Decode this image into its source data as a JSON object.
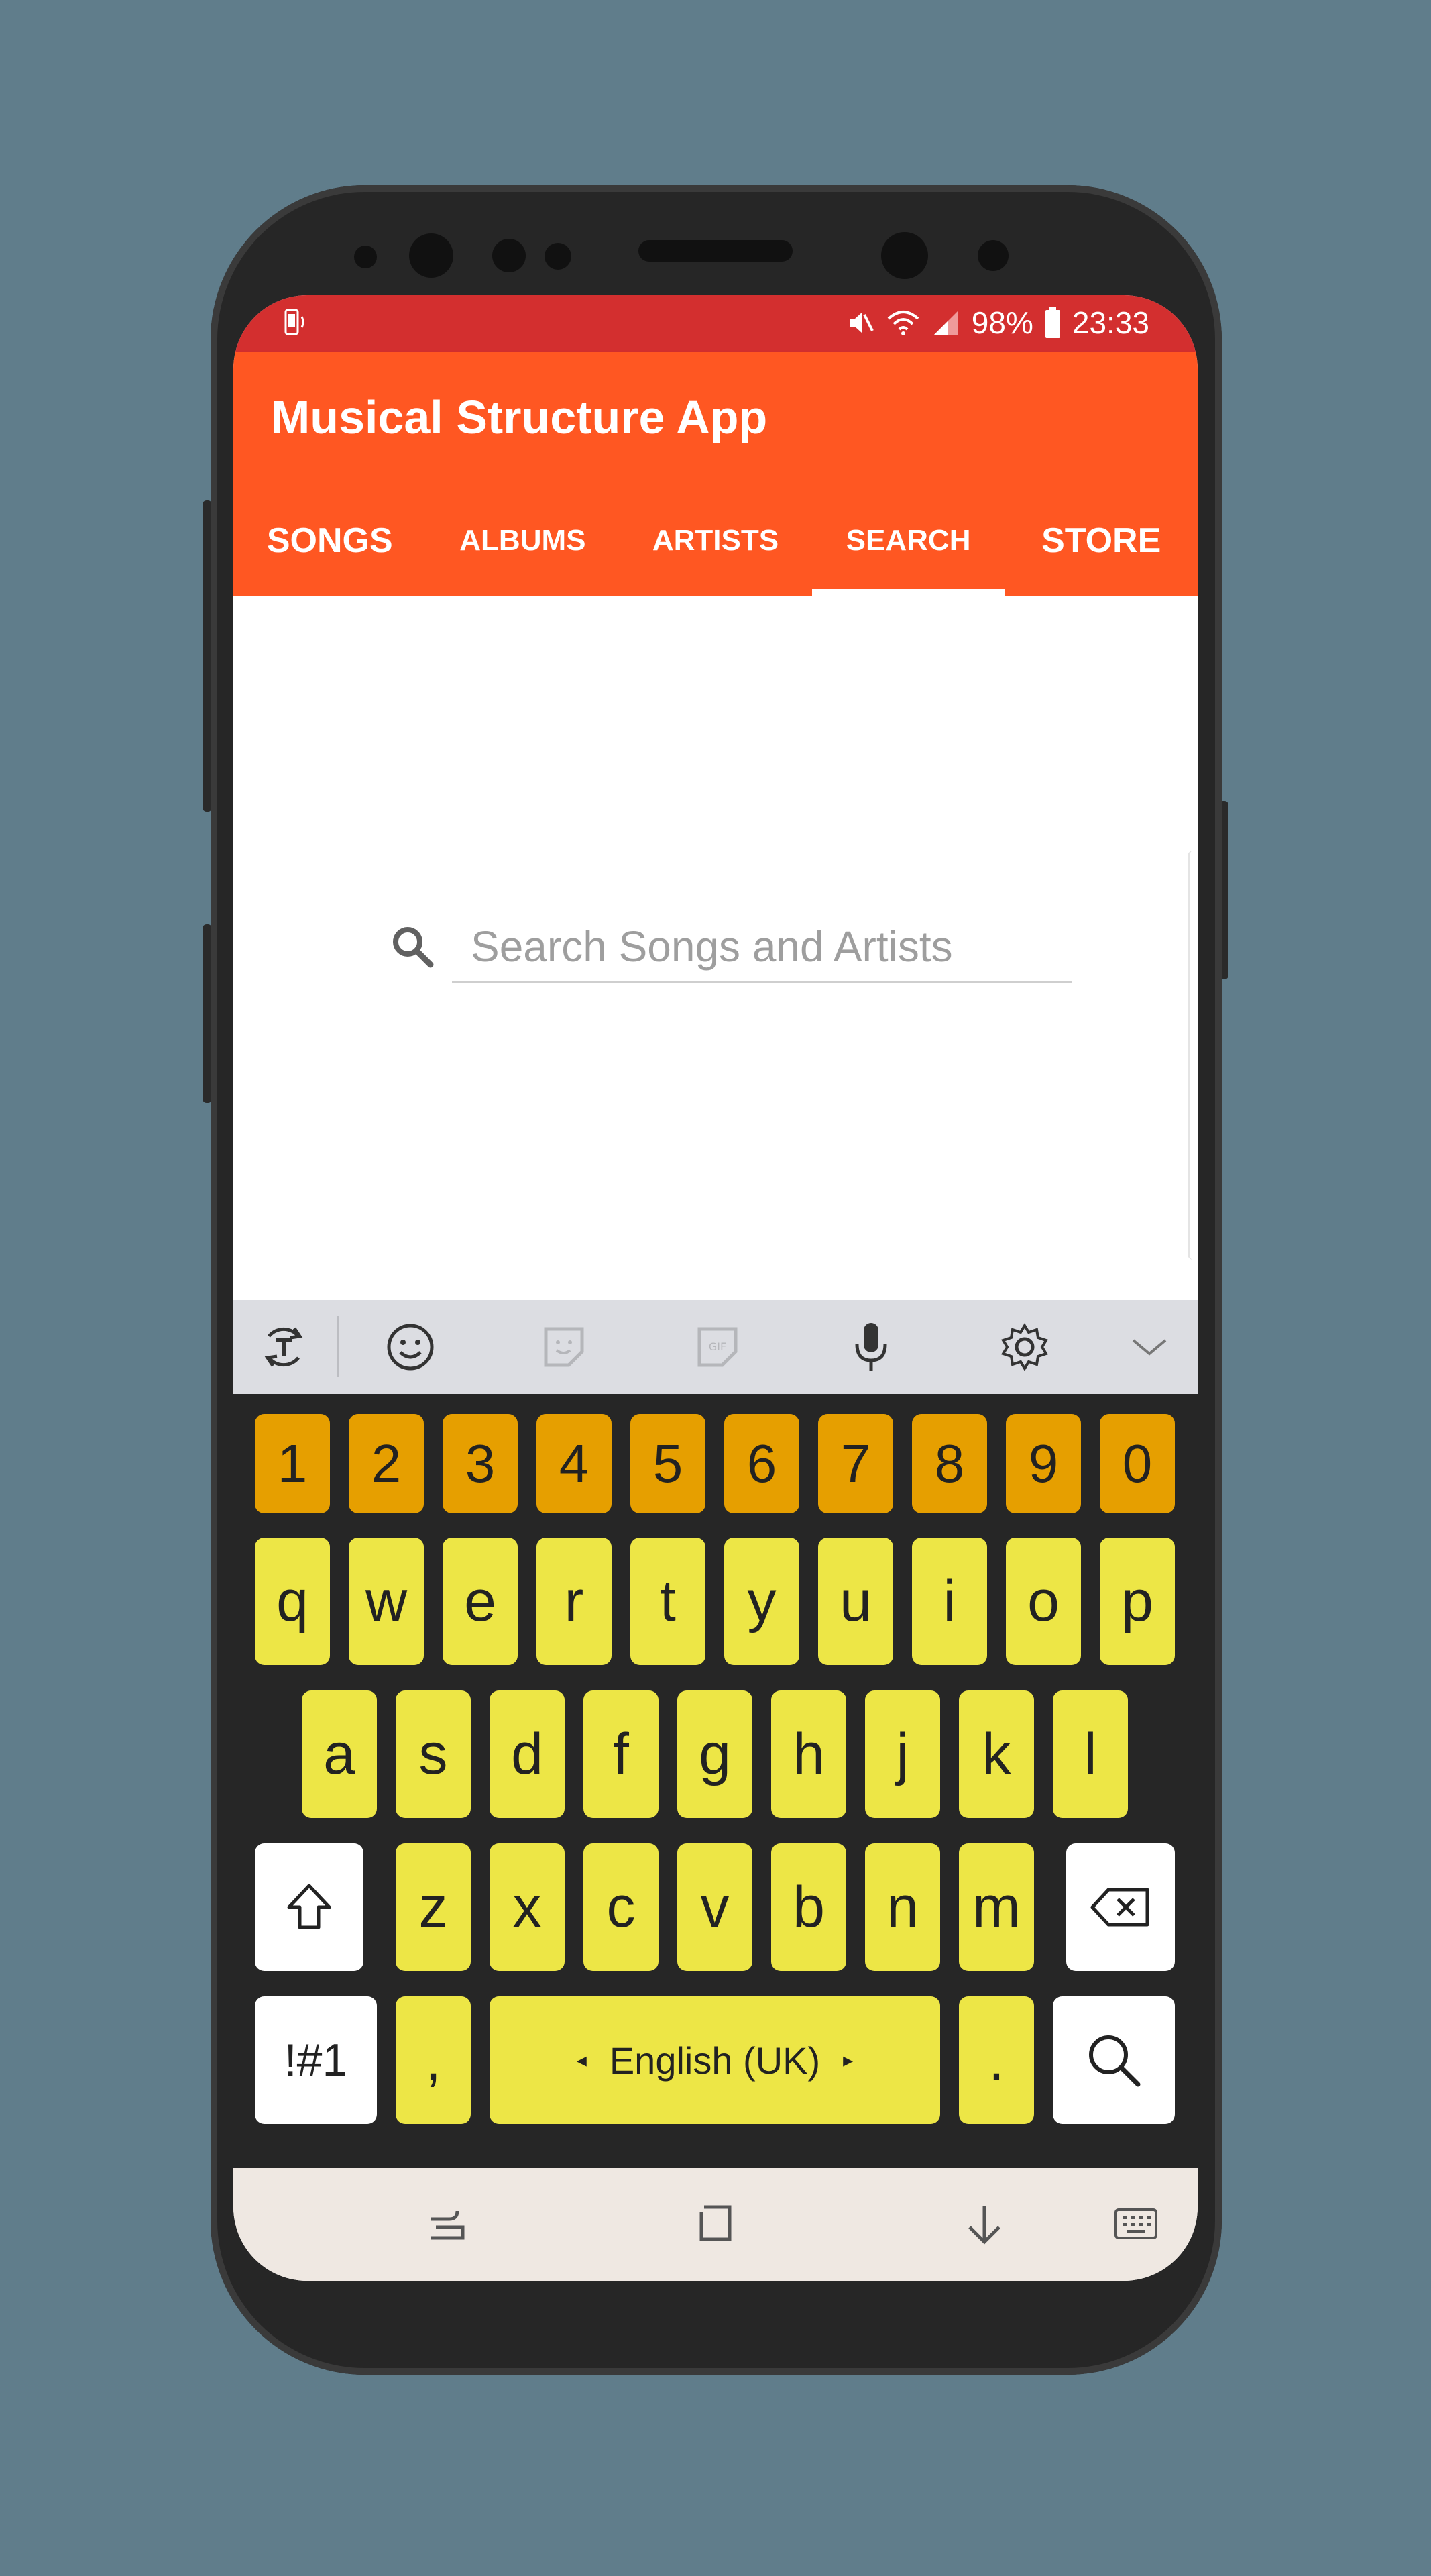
{
  "status_bar": {
    "battery": "98%",
    "time": "23:33"
  },
  "app_bar": {
    "title": "Musical Structure App"
  },
  "tabs": [
    {
      "label": "SONGS",
      "active": false
    },
    {
      "label": "ALBUMS",
      "active": false
    },
    {
      "label": "ARTISTS",
      "active": false
    },
    {
      "label": "SEARCH",
      "active": true
    },
    {
      "label": "STORE",
      "active": false
    }
  ],
  "search": {
    "placeholder": "Search Songs and Artists",
    "value": ""
  },
  "keyboard": {
    "number_row": [
      "1",
      "2",
      "3",
      "4",
      "5",
      "6",
      "7",
      "8",
      "9",
      "0"
    ],
    "row1": [
      "q",
      "w",
      "e",
      "r",
      "t",
      "y",
      "u",
      "i",
      "o",
      "p"
    ],
    "row2": [
      "a",
      "s",
      "d",
      "f",
      "g",
      "h",
      "j",
      "k",
      "l"
    ],
    "row3": [
      "z",
      "x",
      "c",
      "v",
      "b",
      "n",
      "m"
    ],
    "symbols_label": "!#1",
    "comma": ",",
    "space_label": "English (UK)",
    "period": "."
  },
  "colors": {
    "status_bar": "#d32f2f",
    "app_bar": "#ff5722",
    "letter_key": "#ede646",
    "number_key": "#e69f00",
    "background": "#607d8b"
  }
}
